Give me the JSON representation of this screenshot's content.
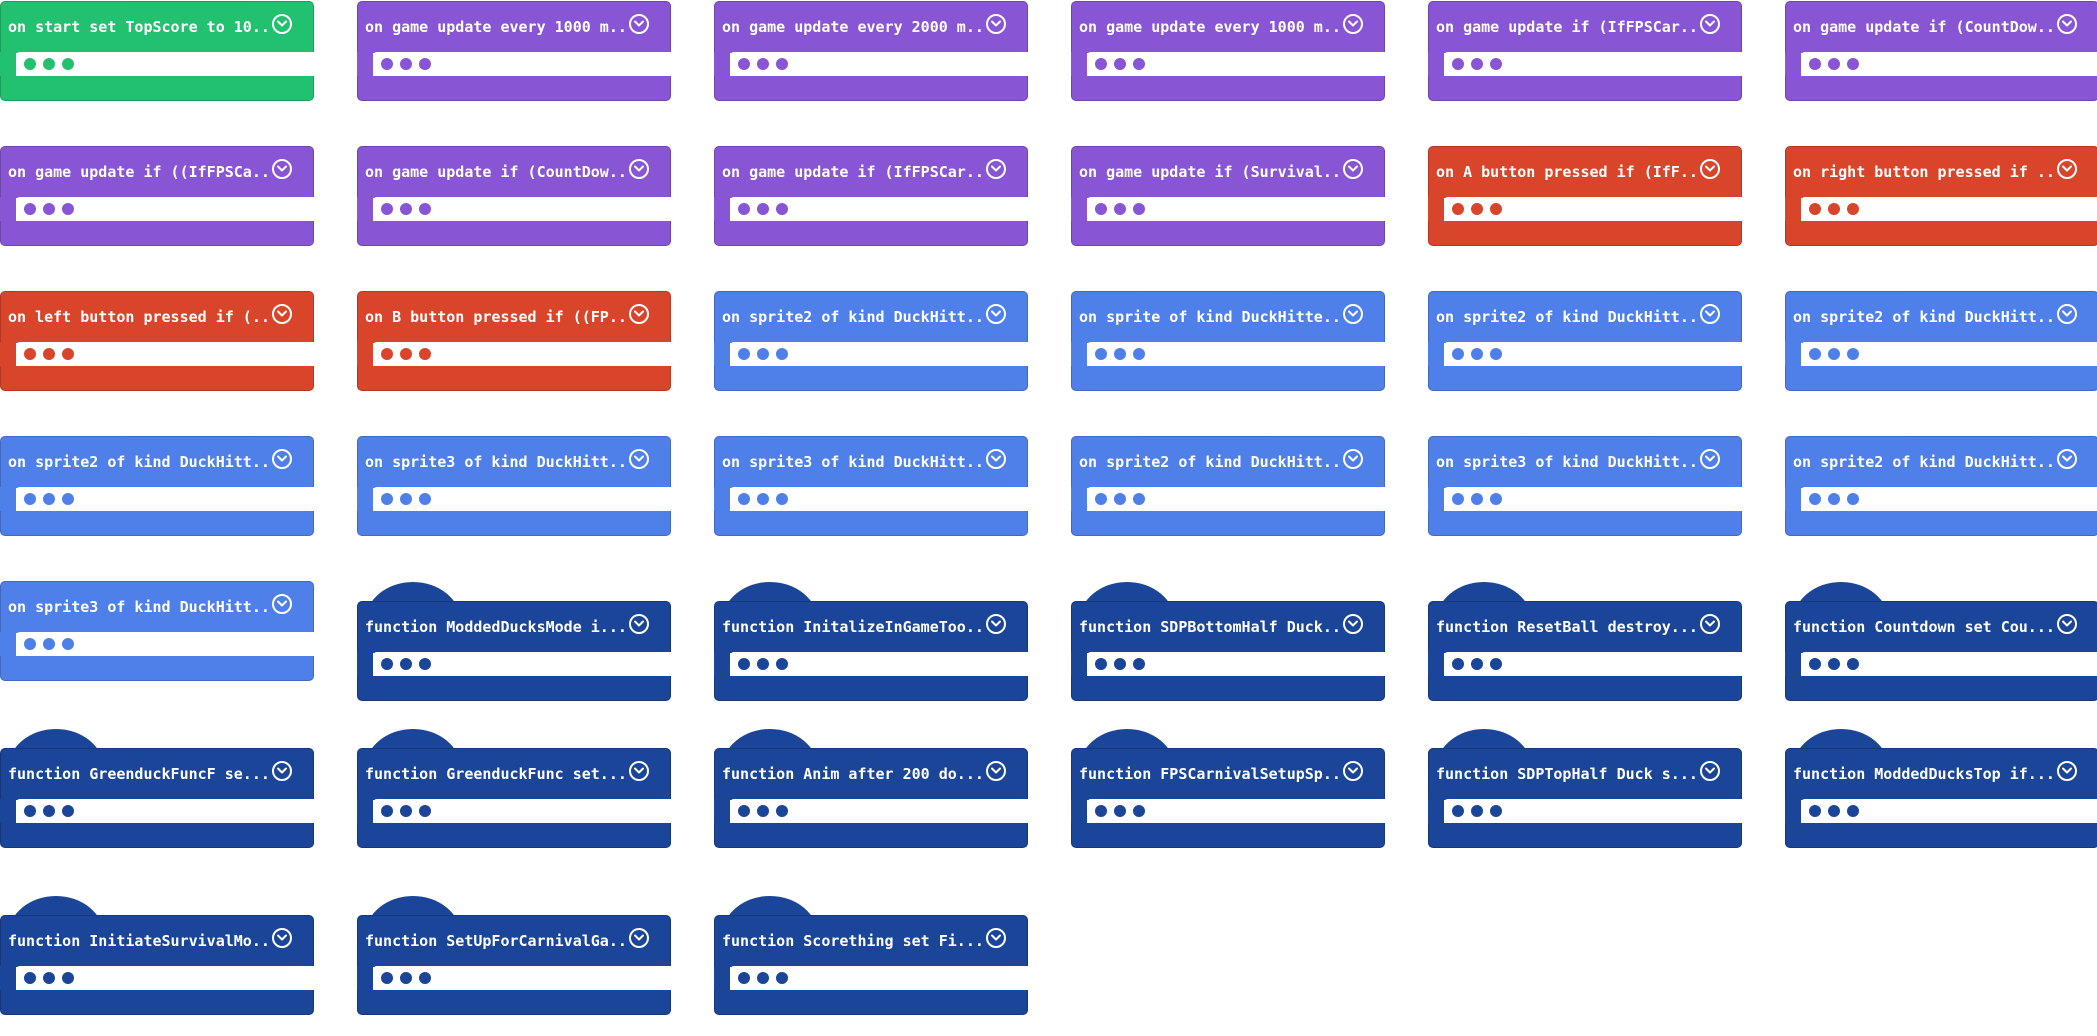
{
  "colors": {
    "event": "#22c16f",
    "loop": "#8855d4",
    "controller": "#d9452a",
    "sprite": "#4f80ea",
    "function": "#1a4598"
  },
  "blocks": [
    {
      "label": "on start set TopScore to 10...",
      "category": "event",
      "hat": false
    },
    {
      "label": "on game update every 1000 m...",
      "category": "loop",
      "hat": false
    },
    {
      "label": "on game update every 2000 m...",
      "category": "loop",
      "hat": false
    },
    {
      "label": "on game update every 1000 m...",
      "category": "loop",
      "hat": false
    },
    {
      "label": "on game update if (IfFPSCar...",
      "category": "loop",
      "hat": false
    },
    {
      "label": "on game update if (CountDow...",
      "category": "loop",
      "hat": false
    },
    {
      "label": "on game update if ((IfFPSCa...",
      "category": "loop",
      "hat": false
    },
    {
      "label": "on game update if (CountDow...",
      "category": "loop",
      "hat": false
    },
    {
      "label": "on game update if (IfFPSCar...",
      "category": "loop",
      "hat": false
    },
    {
      "label": "on game update if (Survival...",
      "category": "loop",
      "hat": false
    },
    {
      "label": "on A button pressed if (IfF...",
      "category": "controller",
      "hat": false
    },
    {
      "label": "on right button pressed if ...",
      "category": "controller",
      "hat": false
    },
    {
      "label": "on left button pressed if (...",
      "category": "controller",
      "hat": false
    },
    {
      "label": "on B button pressed if ((FP...",
      "category": "controller",
      "hat": false
    },
    {
      "label": "on sprite2 of kind DuckHitt...",
      "category": "sprite",
      "hat": false
    },
    {
      "label": "on sprite of kind DuckHitte...",
      "category": "sprite",
      "hat": false
    },
    {
      "label": "on sprite2 of kind DuckHitt...",
      "category": "sprite",
      "hat": false
    },
    {
      "label": "on sprite2 of kind DuckHitt...",
      "category": "sprite",
      "hat": false
    },
    {
      "label": "on sprite2 of kind DuckHitt...",
      "category": "sprite",
      "hat": false
    },
    {
      "label": "on sprite3 of kind DuckHitt...",
      "category": "sprite",
      "hat": false
    },
    {
      "label": "on sprite3 of kind DuckHitt...",
      "category": "sprite",
      "hat": false
    },
    {
      "label": "on sprite2 of kind DuckHitt...",
      "category": "sprite",
      "hat": false
    },
    {
      "label": "on sprite3 of kind DuckHitt...",
      "category": "sprite",
      "hat": false
    },
    {
      "label": "on sprite2 of kind DuckHitt...",
      "category": "sprite",
      "hat": false
    },
    {
      "label": "on sprite3 of kind DuckHitt...",
      "category": "sprite",
      "hat": false
    },
    {
      "label": "function ModdedDucksMode  i...",
      "category": "function",
      "hat": true
    },
    {
      "label": "function InitalizeInGameToo...",
      "category": "function",
      "hat": true
    },
    {
      "label": "function SDPBottomHalf Duck...",
      "category": "function",
      "hat": true
    },
    {
      "label": "function ResetBall  destroy...",
      "category": "function",
      "hat": true
    },
    {
      "label": "function Countdown  set Cou...",
      "category": "function",
      "hat": true
    },
    {
      "label": "function GreenduckFuncF  se...",
      "category": "function",
      "hat": true
    },
    {
      "label": "function GreenduckFunc  set...",
      "category": "function",
      "hat": true
    },
    {
      "label": "function Anim  after 200 do...",
      "category": "function",
      "hat": true
    },
    {
      "label": "function FPSCarnivalSetupSp...",
      "category": "function",
      "hat": true
    },
    {
      "label": "function SDPTopHalf Duck  s...",
      "category": "function",
      "hat": true
    },
    {
      "label": "function ModdedDucksTop  if...",
      "category": "function",
      "hat": true
    },
    {
      "label": "function InitiateSurvivalMo...",
      "category": "function",
      "hat": true
    },
    {
      "label": "function SetUpForCarnivalGa...",
      "category": "function",
      "hat": true
    },
    {
      "label": "function Scorething  set Fi...",
      "category": "function",
      "hat": true
    }
  ]
}
